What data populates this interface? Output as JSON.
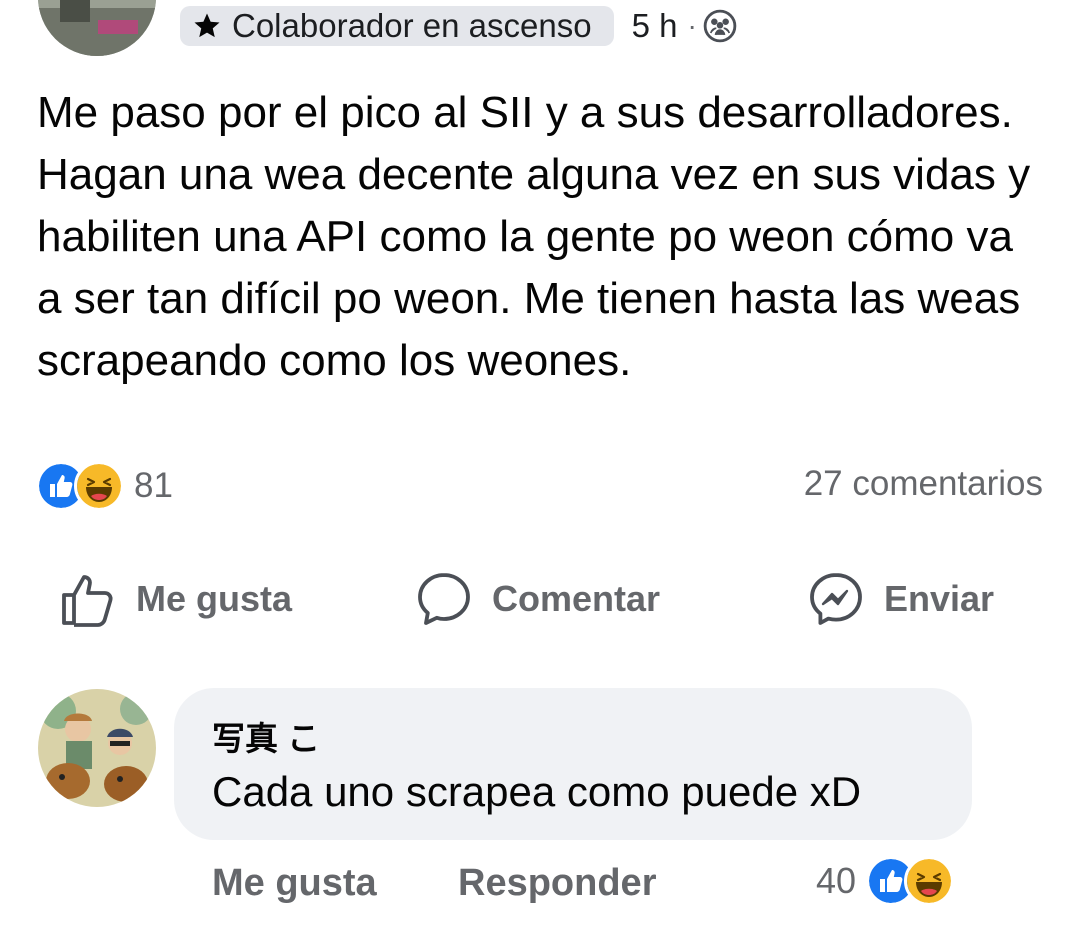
{
  "post": {
    "badge_label": "Colaborador en ascenso",
    "badge_icon": "star-icon",
    "timestamp": "5 h",
    "separator": "·",
    "audience_icon": "group-icon",
    "text": "Me paso por el pico al SII y a sus desarrolladores. Hagan una wea decente alguna vez en sus vidas y habiliten una API como la gente po weon cómo va a ser tan difícil po weon. Me tienen hasta las weas scrapeando como los weones.",
    "reactions": {
      "icons": [
        "like-reaction-icon",
        "haha-reaction-icon"
      ],
      "count": "81"
    },
    "comments_count": "27 comentarios"
  },
  "actions": {
    "like_label": "Me gusta",
    "comment_label": "Comentar",
    "send_label": "Enviar"
  },
  "comment": {
    "author": "写真 こ",
    "text": "Cada uno scrapea como puede xD",
    "like_label": "Me gusta",
    "reply_label": "Responder",
    "reaction_count": "40",
    "reaction_icons": [
      "like-reaction-icon",
      "haha-reaction-icon"
    ]
  },
  "colors": {
    "like_blue": "#1877f2",
    "haha_yellow": "#f7b928",
    "secondary_text": "#65676b",
    "bubble_bg": "#f0f2f5",
    "badge_bg": "#e4e6eb"
  }
}
